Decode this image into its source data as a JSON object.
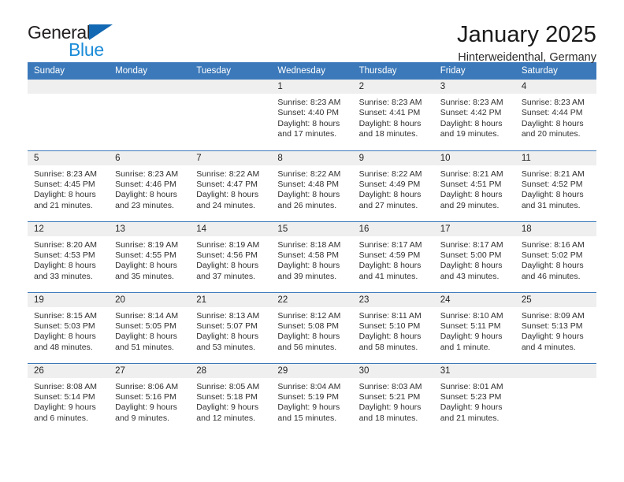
{
  "brand": {
    "name_part1": "General",
    "name_part2": "Blue",
    "accent_color": "#1b8cd8",
    "triangle_color": "#1268b3"
  },
  "header": {
    "title": "January 2025",
    "subtitle": "Hinterweidenthal, Germany"
  },
  "calendar": {
    "header_bg": "#3c79ba",
    "daynum_bg": "#efefef",
    "weekday_headers": [
      "Sunday",
      "Monday",
      "Tuesday",
      "Wednesday",
      "Thursday",
      "Friday",
      "Saturday"
    ],
    "weeks": [
      [
        {
          "day": "",
          "sunrise": "",
          "sunset": "",
          "daylight": "",
          "empty": true
        },
        {
          "day": "",
          "sunrise": "",
          "sunset": "",
          "daylight": "",
          "empty": true
        },
        {
          "day": "",
          "sunrise": "",
          "sunset": "",
          "daylight": "",
          "empty": true
        },
        {
          "day": "1",
          "sunrise": "Sunrise: 8:23 AM",
          "sunset": "Sunset: 4:40 PM",
          "daylight": "Daylight: 8 hours and 17 minutes."
        },
        {
          "day": "2",
          "sunrise": "Sunrise: 8:23 AM",
          "sunset": "Sunset: 4:41 PM",
          "daylight": "Daylight: 8 hours and 18 minutes."
        },
        {
          "day": "3",
          "sunrise": "Sunrise: 8:23 AM",
          "sunset": "Sunset: 4:42 PM",
          "daylight": "Daylight: 8 hours and 19 minutes."
        },
        {
          "day": "4",
          "sunrise": "Sunrise: 8:23 AM",
          "sunset": "Sunset: 4:44 PM",
          "daylight": "Daylight: 8 hours and 20 minutes."
        }
      ],
      [
        {
          "day": "5",
          "sunrise": "Sunrise: 8:23 AM",
          "sunset": "Sunset: 4:45 PM",
          "daylight": "Daylight: 8 hours and 21 minutes."
        },
        {
          "day": "6",
          "sunrise": "Sunrise: 8:23 AM",
          "sunset": "Sunset: 4:46 PM",
          "daylight": "Daylight: 8 hours and 23 minutes."
        },
        {
          "day": "7",
          "sunrise": "Sunrise: 8:22 AM",
          "sunset": "Sunset: 4:47 PM",
          "daylight": "Daylight: 8 hours and 24 minutes."
        },
        {
          "day": "8",
          "sunrise": "Sunrise: 8:22 AM",
          "sunset": "Sunset: 4:48 PM",
          "daylight": "Daylight: 8 hours and 26 minutes."
        },
        {
          "day": "9",
          "sunrise": "Sunrise: 8:22 AM",
          "sunset": "Sunset: 4:49 PM",
          "daylight": "Daylight: 8 hours and 27 minutes."
        },
        {
          "day": "10",
          "sunrise": "Sunrise: 8:21 AM",
          "sunset": "Sunset: 4:51 PM",
          "daylight": "Daylight: 8 hours and 29 minutes."
        },
        {
          "day": "11",
          "sunrise": "Sunrise: 8:21 AM",
          "sunset": "Sunset: 4:52 PM",
          "daylight": "Daylight: 8 hours and 31 minutes."
        }
      ],
      [
        {
          "day": "12",
          "sunrise": "Sunrise: 8:20 AM",
          "sunset": "Sunset: 4:53 PM",
          "daylight": "Daylight: 8 hours and 33 minutes."
        },
        {
          "day": "13",
          "sunrise": "Sunrise: 8:19 AM",
          "sunset": "Sunset: 4:55 PM",
          "daylight": "Daylight: 8 hours and 35 minutes."
        },
        {
          "day": "14",
          "sunrise": "Sunrise: 8:19 AM",
          "sunset": "Sunset: 4:56 PM",
          "daylight": "Daylight: 8 hours and 37 minutes."
        },
        {
          "day": "15",
          "sunrise": "Sunrise: 8:18 AM",
          "sunset": "Sunset: 4:58 PM",
          "daylight": "Daylight: 8 hours and 39 minutes."
        },
        {
          "day": "16",
          "sunrise": "Sunrise: 8:17 AM",
          "sunset": "Sunset: 4:59 PM",
          "daylight": "Daylight: 8 hours and 41 minutes."
        },
        {
          "day": "17",
          "sunrise": "Sunrise: 8:17 AM",
          "sunset": "Sunset: 5:00 PM",
          "daylight": "Daylight: 8 hours and 43 minutes."
        },
        {
          "day": "18",
          "sunrise": "Sunrise: 8:16 AM",
          "sunset": "Sunset: 5:02 PM",
          "daylight": "Daylight: 8 hours and 46 minutes."
        }
      ],
      [
        {
          "day": "19",
          "sunrise": "Sunrise: 8:15 AM",
          "sunset": "Sunset: 5:03 PM",
          "daylight": "Daylight: 8 hours and 48 minutes."
        },
        {
          "day": "20",
          "sunrise": "Sunrise: 8:14 AM",
          "sunset": "Sunset: 5:05 PM",
          "daylight": "Daylight: 8 hours and 51 minutes."
        },
        {
          "day": "21",
          "sunrise": "Sunrise: 8:13 AM",
          "sunset": "Sunset: 5:07 PM",
          "daylight": "Daylight: 8 hours and 53 minutes."
        },
        {
          "day": "22",
          "sunrise": "Sunrise: 8:12 AM",
          "sunset": "Sunset: 5:08 PM",
          "daylight": "Daylight: 8 hours and 56 minutes."
        },
        {
          "day": "23",
          "sunrise": "Sunrise: 8:11 AM",
          "sunset": "Sunset: 5:10 PM",
          "daylight": "Daylight: 8 hours and 58 minutes."
        },
        {
          "day": "24",
          "sunrise": "Sunrise: 8:10 AM",
          "sunset": "Sunset: 5:11 PM",
          "daylight": "Daylight: 9 hours and 1 minute."
        },
        {
          "day": "25",
          "sunrise": "Sunrise: 8:09 AM",
          "sunset": "Sunset: 5:13 PM",
          "daylight": "Daylight: 9 hours and 4 minutes."
        }
      ],
      [
        {
          "day": "26",
          "sunrise": "Sunrise: 8:08 AM",
          "sunset": "Sunset: 5:14 PM",
          "daylight": "Daylight: 9 hours and 6 minutes."
        },
        {
          "day": "27",
          "sunrise": "Sunrise: 8:06 AM",
          "sunset": "Sunset: 5:16 PM",
          "daylight": "Daylight: 9 hours and 9 minutes."
        },
        {
          "day": "28",
          "sunrise": "Sunrise: 8:05 AM",
          "sunset": "Sunset: 5:18 PM",
          "daylight": "Daylight: 9 hours and 12 minutes."
        },
        {
          "day": "29",
          "sunrise": "Sunrise: 8:04 AM",
          "sunset": "Sunset: 5:19 PM",
          "daylight": "Daylight: 9 hours and 15 minutes."
        },
        {
          "day": "30",
          "sunrise": "Sunrise: 8:03 AM",
          "sunset": "Sunset: 5:21 PM",
          "daylight": "Daylight: 9 hours and 18 minutes."
        },
        {
          "day": "31",
          "sunrise": "Sunrise: 8:01 AM",
          "sunset": "Sunset: 5:23 PM",
          "daylight": "Daylight: 9 hours and 21 minutes."
        },
        {
          "day": "",
          "sunrise": "",
          "sunset": "",
          "daylight": "",
          "empty": true
        }
      ]
    ]
  }
}
